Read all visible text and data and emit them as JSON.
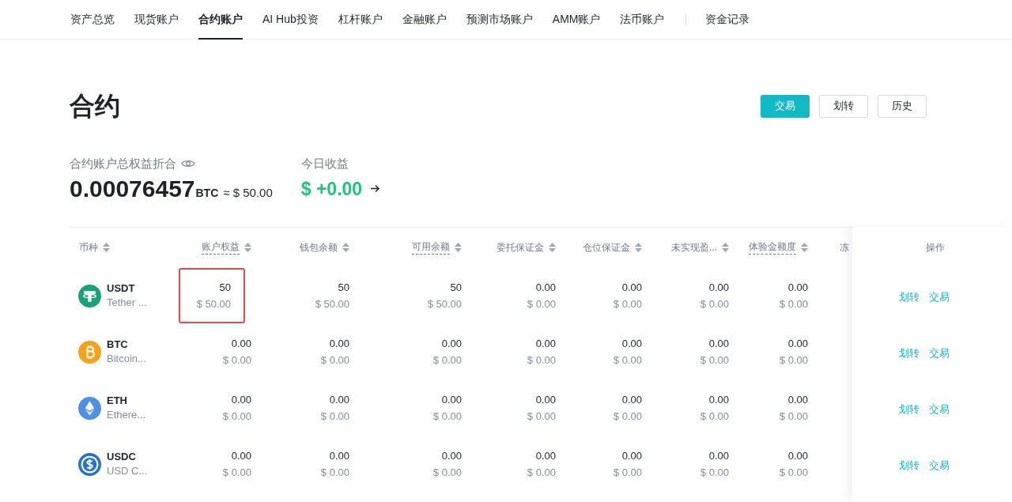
{
  "nav": {
    "tabs": [
      {
        "label": "资产总览",
        "selected": false
      },
      {
        "label": "现货账户",
        "selected": false
      },
      {
        "label": "合约账户",
        "selected": true
      },
      {
        "label": "AI Hub投资",
        "selected": false
      },
      {
        "label": "杠杆账户",
        "selected": false
      },
      {
        "label": "金融账户",
        "selected": false
      },
      {
        "label": "预测市场账户",
        "selected": false
      },
      {
        "label": "AMM账户",
        "selected": false
      },
      {
        "label": "法币账户",
        "selected": false
      }
    ],
    "extra_link": "资金记录"
  },
  "page_title": "合约",
  "header_buttons": [
    {
      "label": "交易",
      "kind": "primary"
    },
    {
      "label": "划转",
      "kind": "outline"
    },
    {
      "label": "历史",
      "kind": "outline"
    }
  ],
  "summary": {
    "equity_label": "合约账户总权益折合",
    "equity_value": "0.00076457",
    "equity_unit": "BTC",
    "equity_usd": "≈ $ 50.00",
    "pnl_label": "今日收益",
    "pnl_value": "$ +0.00"
  },
  "table": {
    "columns": [
      {
        "label": "币种",
        "dashed": false,
        "sortable": true
      },
      {
        "label": "账户权益",
        "dashed": true,
        "sortable": true
      },
      {
        "label": "钱包余额",
        "dashed": false,
        "sortable": true
      },
      {
        "label": "可用余额",
        "dashed": true,
        "sortable": true
      },
      {
        "label": "委托保证金",
        "dashed": false,
        "sortable": true
      },
      {
        "label": "仓位保证金",
        "dashed": false,
        "sortable": true
      },
      {
        "label": "未实现盈...",
        "dashed": false,
        "sortable": true
      },
      {
        "label": "体验金额度",
        "dashed": true,
        "sortable": true
      },
      {
        "label": "冻",
        "dashed": false,
        "sortable": false
      }
    ],
    "actions_header": "操作",
    "rows": [
      {
        "symbol": "USDT",
        "name": "Tether ...",
        "kind": "usdt",
        "highlighted": true,
        "cells": [
          [
            "50",
            "$ 50.00"
          ],
          [
            "50",
            "$ 50.00"
          ],
          [
            "50",
            "$ 50.00"
          ],
          [
            "0.00",
            "$ 0.00"
          ],
          [
            "0.00",
            "$ 0.00"
          ],
          [
            "0.00",
            "$ 0.00"
          ],
          [
            "0.00",
            "$ 0.00"
          ]
        ],
        "actions": [
          "划转",
          "交易"
        ]
      },
      {
        "symbol": "BTC",
        "name": "Bitcoin...",
        "kind": "btc",
        "highlighted": false,
        "cells": [
          [
            "0.00",
            "$ 0.00"
          ],
          [
            "0.00",
            "$ 0.00"
          ],
          [
            "0.00",
            "$ 0.00"
          ],
          [
            "0.00",
            "$ 0.00"
          ],
          [
            "0.00",
            "$ 0.00"
          ],
          [
            "0.00",
            "$ 0.00"
          ],
          [
            "0.00",
            "$ 0.00"
          ]
        ],
        "actions": [
          "划转",
          "交易"
        ]
      },
      {
        "symbol": "ETH",
        "name": "Ethere...",
        "kind": "eth",
        "highlighted": false,
        "cells": [
          [
            "0.00",
            "$ 0.00"
          ],
          [
            "0.00",
            "$ 0.00"
          ],
          [
            "0.00",
            "$ 0.00"
          ],
          [
            "0.00",
            "$ 0.00"
          ],
          [
            "0.00",
            "$ 0.00"
          ],
          [
            "0.00",
            "$ 0.00"
          ],
          [
            "0.00",
            "$ 0.00"
          ]
        ],
        "actions": [
          "划转",
          "交易"
        ]
      },
      {
        "symbol": "USDC",
        "name": "USD C...",
        "kind": "usdc",
        "highlighted": false,
        "cells": [
          [
            "0.00",
            "$ 0.00"
          ],
          [
            "0.00",
            "$ 0.00"
          ],
          [
            "0.00",
            "$ 0.00"
          ],
          [
            "0.00",
            "$ 0.00"
          ],
          [
            "0.00",
            "$ 0.00"
          ],
          [
            "0.00",
            "$ 0.00"
          ],
          [
            "0.00",
            "$ 0.00"
          ]
        ],
        "actions": [
          "划转",
          "交易"
        ]
      }
    ]
  }
}
